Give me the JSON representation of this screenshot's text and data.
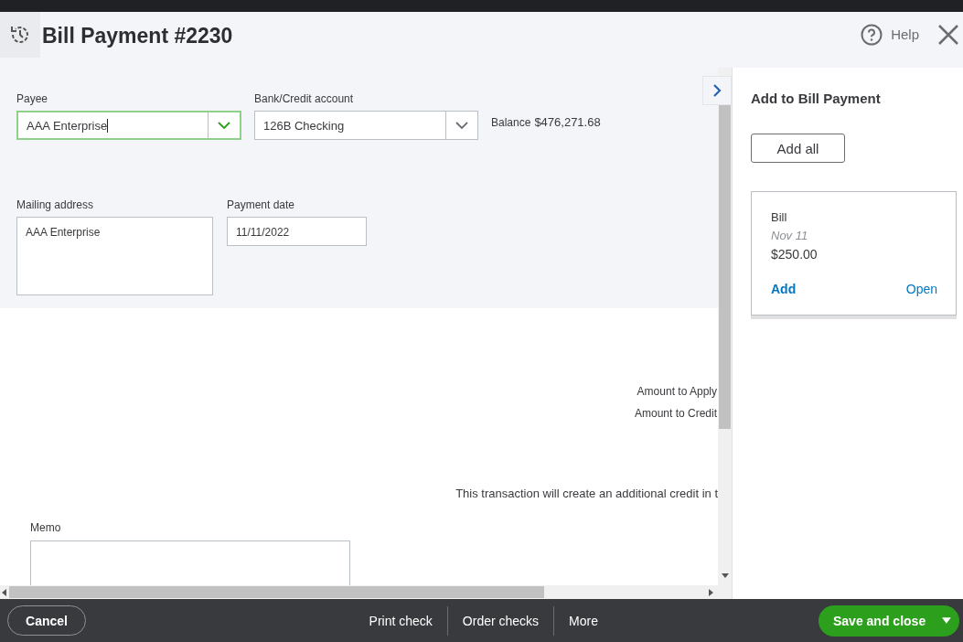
{
  "header": {
    "title": "Bill Payment #2230",
    "help": "Help"
  },
  "form": {
    "payee": {
      "label": "Payee",
      "value": "AAA Enterprise",
      "focused": true
    },
    "account": {
      "label": "Bank/Credit account",
      "value": "126B Checking"
    },
    "balance": {
      "label": "Balance",
      "value": "$476,271.68"
    },
    "mailing_address": {
      "label": "Mailing address",
      "value": "AAA Enterprise"
    },
    "payment_date": {
      "label": "Payment date",
      "value": "11/11/2022"
    }
  },
  "totals": [
    "Amount to Apply",
    "Amount to Credit"
  ],
  "notice": "This transaction will create an additional credit in t",
  "memo": {
    "label": "Memo"
  },
  "side_panel": {
    "title": "Add to Bill Payment",
    "add_all": "Add all",
    "cards": [
      {
        "type": "Bill",
        "date": "Nov 11",
        "amount": "$250.00",
        "add": "Add",
        "open": "Open"
      }
    ]
  },
  "footer": {
    "cancel": "Cancel",
    "actions": [
      "Print check",
      "Order checks",
      "More"
    ],
    "save": "Save and close"
  }
}
